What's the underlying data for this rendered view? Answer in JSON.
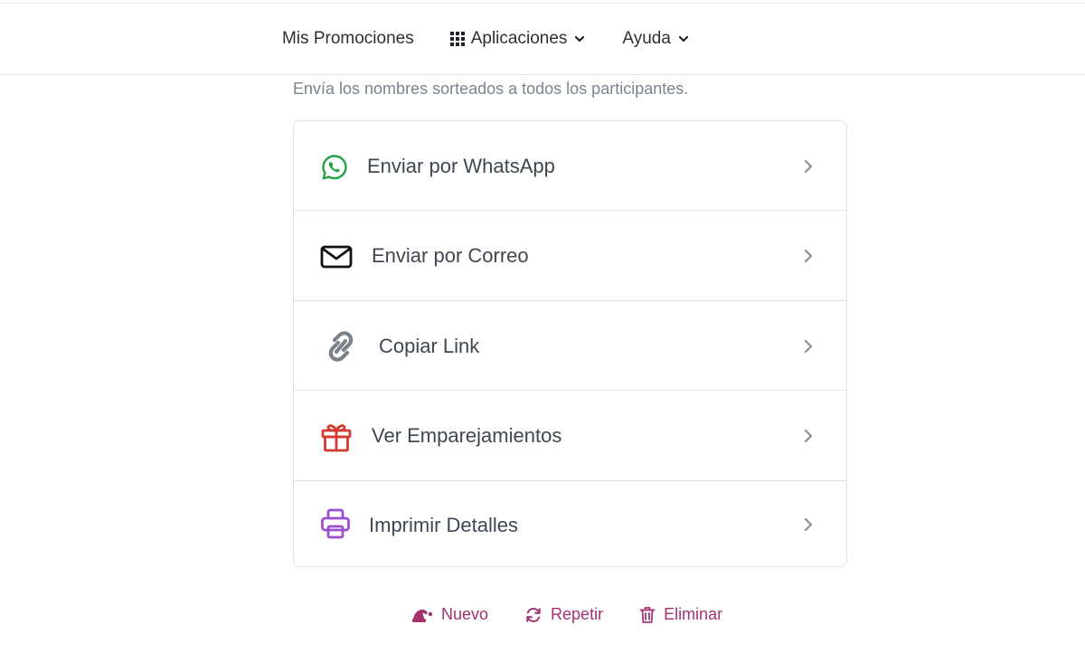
{
  "nav": {
    "items": [
      {
        "label": "Mis Promociones",
        "icon": "none",
        "dropdown": false
      },
      {
        "label": "Aplicaciones",
        "icon": "grid-icon",
        "dropdown": true
      },
      {
        "label": "Ayuda",
        "icon": "none",
        "dropdown": true
      }
    ]
  },
  "share": {
    "subtitle": "Envía los nombres sorteados a todos los participantes.",
    "options": [
      {
        "label": "Enviar por WhatsApp",
        "icon": "whatsapp-icon",
        "color": "#25a244"
      },
      {
        "label": "Enviar por Correo",
        "icon": "envelope-icon",
        "color": "#111111"
      },
      {
        "label": "Copiar Link",
        "icon": "link-icon",
        "color": "#7c828a"
      },
      {
        "label": "Ver Emparejamientos",
        "icon": "gift-icon",
        "color": "#d13b31"
      },
      {
        "label": "Imprimir Detalles",
        "icon": "printer-icon",
        "color": "#9b4fd1"
      }
    ]
  },
  "actions": {
    "items": [
      {
        "label": "Nuevo",
        "icon": "santa-hat-icon"
      },
      {
        "label": "Repetir",
        "icon": "refresh-icon"
      },
      {
        "label": "Eliminar",
        "icon": "trash-icon"
      }
    ],
    "color": "#a3326f"
  }
}
